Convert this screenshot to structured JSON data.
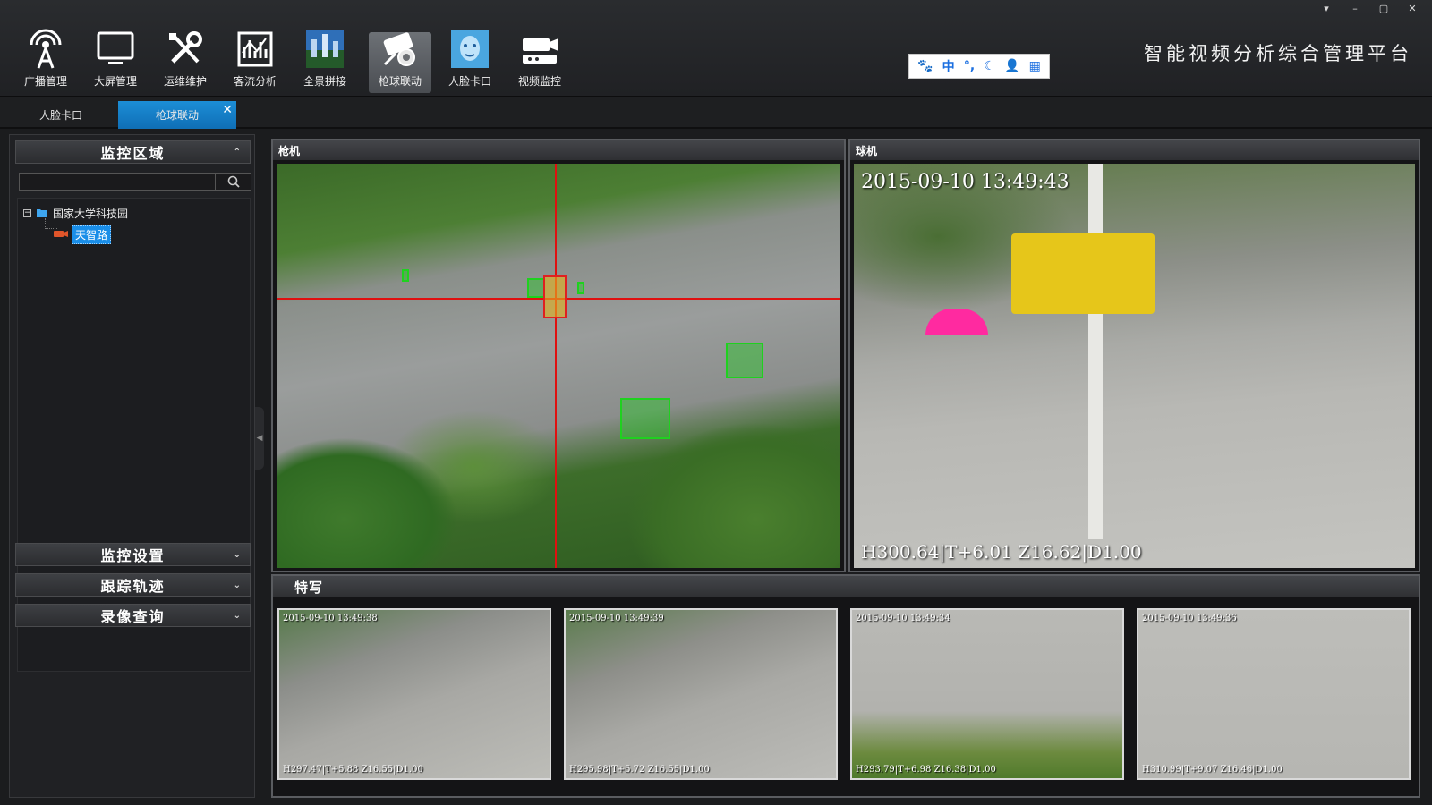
{
  "window": {
    "controls": [
      "▾",
      "–",
      "▢",
      "✕"
    ]
  },
  "app_title": "智能视频分析综合管理平台",
  "toolbar": {
    "items": [
      {
        "label": "广播管理",
        "icon": "antenna-icon"
      },
      {
        "label": "大屏管理",
        "icon": "monitor-icon"
      },
      {
        "label": "运维维护",
        "icon": "tools-icon"
      },
      {
        "label": "客流分析",
        "icon": "chart-icon"
      },
      {
        "label": "全景拼接",
        "icon": "panorama-icon"
      },
      {
        "label": "枪球联动",
        "icon": "camera-linkage-icon",
        "active": true
      },
      {
        "label": "人脸卡口",
        "icon": "face-icon"
      },
      {
        "label": "视频监控",
        "icon": "video-camera-icon"
      }
    ]
  },
  "ime_bar": {
    "items": [
      "🐾",
      "中",
      "°,",
      "☾",
      "👤",
      "▦"
    ]
  },
  "tabs": [
    {
      "label": "人脸卡口"
    },
    {
      "label": "枪球联动",
      "active": true,
      "close": "✕"
    }
  ],
  "left_panel": {
    "monitor_area": {
      "title": "监控区域",
      "chevron": "⌃"
    },
    "search": {
      "value": "",
      "placeholder": ""
    },
    "tree": {
      "root": {
        "label": "国家大学科技园",
        "expander": "−"
      },
      "child": {
        "label": "天智路"
      }
    },
    "sections": [
      {
        "title": "监控设置",
        "chevron": "⌄"
      },
      {
        "title": "跟踪轨迹",
        "chevron": "⌄"
      },
      {
        "title": "录像查询",
        "chevron": "⌄"
      }
    ]
  },
  "gun_camera": {
    "title": "枪机"
  },
  "ball_camera": {
    "title": "球机",
    "timestamp": "2015-09-10  13:49:43",
    "ptz": "H300.64|T+6.01   Z16.62|D1.00"
  },
  "closeup": {
    "title": "特写",
    "thumbs": [
      {
        "time": "2015-09-10 13:49:38",
        "ptz": "H297.47|T+5.88   Z16.55|D1.00"
      },
      {
        "time": "2015-09-10 13:49:39",
        "ptz": "H295.98|T+5.72   Z16.55|D1.00"
      },
      {
        "time": "2015-09-10 13:49:34",
        "ptz": "H293.79|T+6.98   Z16.38|D1.00"
      },
      {
        "time": "2015-09-10 13:49:36",
        "ptz": "H310.99|T+9.07   Z16.46|D1.00"
      }
    ]
  }
}
